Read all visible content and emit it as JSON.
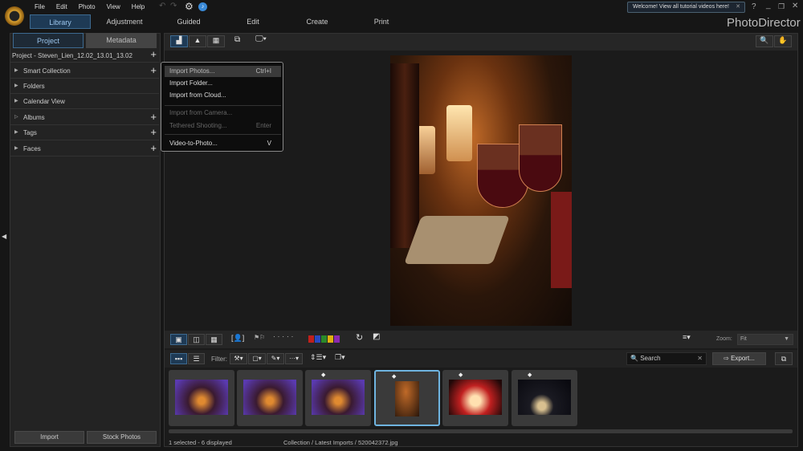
{
  "app": {
    "title": "PhotoDirector",
    "tooltip": "Welcome! View all tutorial videos here!"
  },
  "menu": [
    "File",
    "Edit",
    "Photo",
    "View",
    "Help"
  ],
  "modules": [
    {
      "label": "Library",
      "active": true
    },
    {
      "label": "Adjustment"
    },
    {
      "label": "Guided"
    },
    {
      "label": "Edit"
    },
    {
      "label": "Create"
    },
    {
      "label": "Print"
    }
  ],
  "left": {
    "tabs": [
      "Project",
      "Metadata"
    ],
    "project": "Project - Steven_Lien_12.02_13.01_13.02",
    "tree": [
      {
        "label": "Smart Collection",
        "plus": true
      },
      {
        "label": "Folders",
        "plus": false
      },
      {
        "label": "Calendar View",
        "plus": false
      },
      {
        "label": "Albums",
        "plus": true
      },
      {
        "label": "Tags",
        "plus": true
      },
      {
        "label": "Faces",
        "plus": true
      }
    ],
    "import": "Import",
    "stock": "Stock Photos"
  },
  "dropdown": [
    {
      "label": "Import Photos...",
      "shortcut": "Ctrl+I",
      "highlighted": true
    },
    {
      "label": "Import Folder..."
    },
    {
      "label": "Import from Cloud..."
    },
    {
      "label": "Import from Camera...",
      "disabled": true
    },
    {
      "label": "Tethered Shooting...",
      "shortcut": "Enter",
      "disabled": true
    },
    {
      "label": "Video-to-Photo...",
      "shortcut": "V"
    }
  ],
  "toolbar": {
    "zoom_label": "Zoom:",
    "zoom_value": "Fit",
    "filter_label": "Filter:",
    "search_placeholder": "Search",
    "export": "Export...",
    "colors": [
      "#c0201c",
      "#2a48c0",
      "#2a8a2a",
      "#e0b010",
      "#8a2ab0"
    ]
  },
  "thumbnails": [
    {
      "tagged": false,
      "selected": false,
      "kind": "purple"
    },
    {
      "tagged": false,
      "selected": false,
      "kind": "purple"
    },
    {
      "tagged": true,
      "selected": false,
      "kind": "purple"
    },
    {
      "tagged": true,
      "selected": true,
      "kind": "wine"
    },
    {
      "tagged": true,
      "selected": false,
      "kind": "candles"
    },
    {
      "tagged": true,
      "selected": false,
      "kind": "bokeh"
    }
  ],
  "status": {
    "selection": "1 selected - 6 displayed",
    "path": "Collection / Latest Imports / 520042372.jpg"
  }
}
